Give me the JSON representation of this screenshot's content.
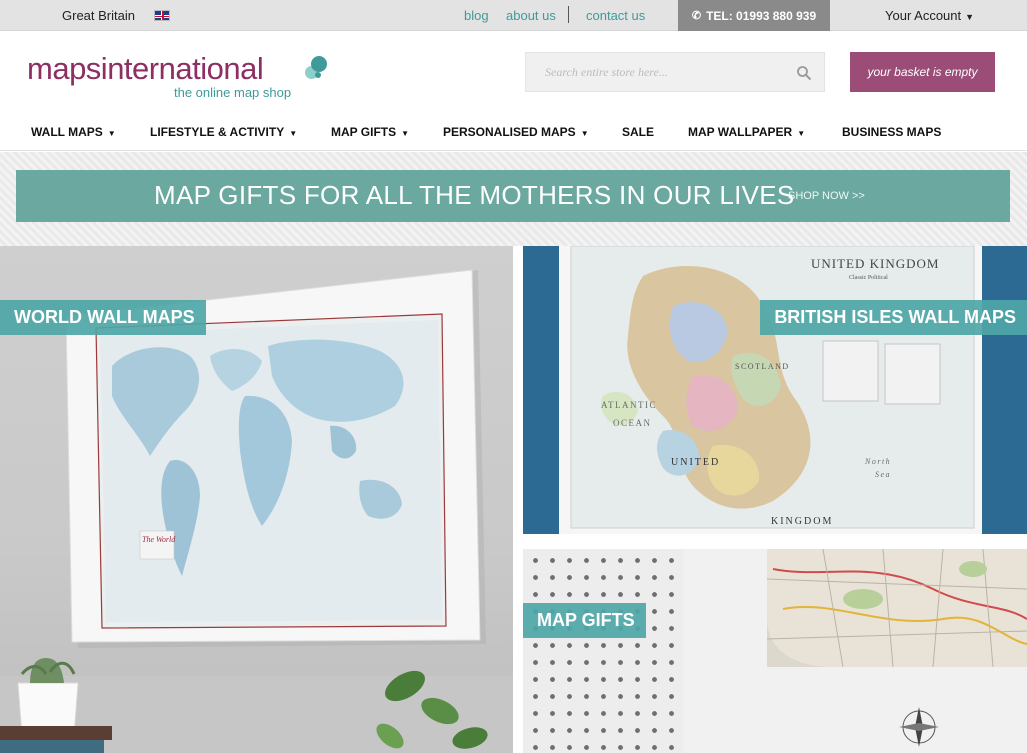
{
  "topbar": {
    "country": "Great Britain",
    "links": {
      "blog": "blog",
      "about": "about us",
      "contact": "contact us"
    },
    "telephone": "TEL: 01993 880 939",
    "account": "Your Account"
  },
  "header": {
    "logo_name": "mapsinternational",
    "logo_tagline": "the online map shop",
    "search_placeholder": "Search entire store here...",
    "basket": "your basket is empty"
  },
  "nav": {
    "items": [
      {
        "label": "WALL MAPS",
        "has_dropdown": true
      },
      {
        "label": "LIFESTYLE & ACTIVITY",
        "has_dropdown": true
      },
      {
        "label": "MAP GIFTS",
        "has_dropdown": true
      },
      {
        "label": "PERSONALISED MAPS",
        "has_dropdown": true
      },
      {
        "label": "SALE",
        "has_dropdown": false
      },
      {
        "label": "MAP WALLPAPER",
        "has_dropdown": true
      },
      {
        "label": "BUSINESS MAPS",
        "has_dropdown": false
      }
    ]
  },
  "banner": {
    "title": "MAP GIFTS FOR ALL THE MOTHERS IN OUR LIVES",
    "cta": "SHOP NOW >>"
  },
  "tiles": {
    "world": {
      "label": "WORLD WALL MAPS",
      "map_title": "The World"
    },
    "uk": {
      "label": "BRITISH ISLES WALL MAPS",
      "map_title": "UNITED KINGDOM",
      "map_subtitle": "Classic Political",
      "sea_atlantic": "ATLANTIC",
      "sea_ocean": "OCEAN",
      "country_united": "UNITED",
      "country_kingdom": "KINGDOM",
      "sea_north": "North",
      "sea_sea": "Sea",
      "region": "SCOTLAND"
    },
    "gifts": {
      "label": "MAP GIFTS"
    }
  },
  "colors": {
    "brand_purple": "#8d2f63",
    "brand_teal": "#3f9a9a",
    "banner_teal": "#6aa8a0",
    "basket_button": "#9b4d77",
    "tile_label": "#4ea6a6"
  }
}
